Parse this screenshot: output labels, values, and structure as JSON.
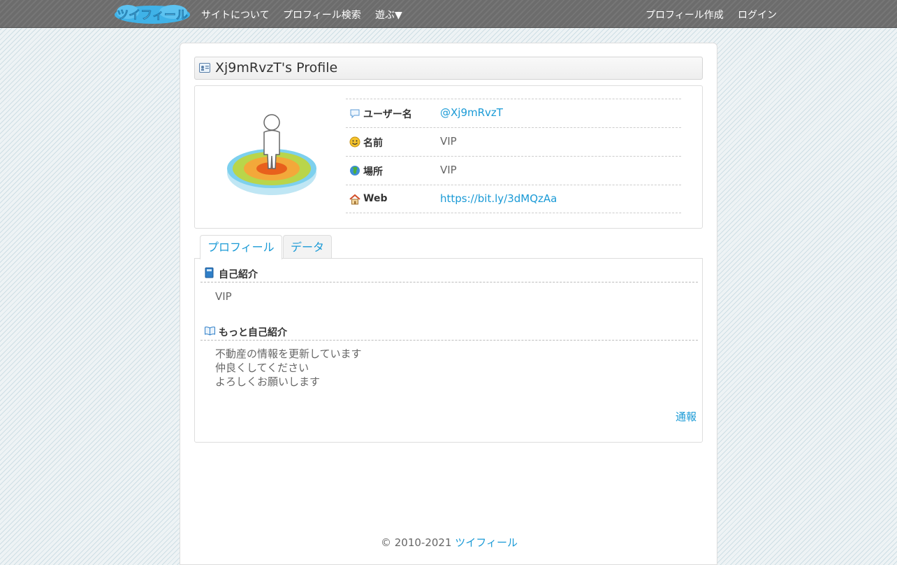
{
  "navbar": {
    "logo_text": "ツイフィール",
    "links_left": [
      "サイトについて",
      "プロフィール検索",
      "遊ぶ▼"
    ],
    "links_right": [
      "プロフィール作成",
      "ログイン"
    ]
  },
  "profile": {
    "title": "Xj9mRvzT's Profile",
    "fields": [
      {
        "label": "ユーザー名",
        "value": "@Xj9mRvzT",
        "icon": "speech-bubble-icon"
      },
      {
        "label": "名前",
        "value": "VIP",
        "icon": "smiley-icon"
      },
      {
        "label": "場所",
        "value": "VIP",
        "icon": "globe-icon"
      },
      {
        "label": "Web",
        "value": "https://bit.ly/3dMQzAa",
        "icon": "house-icon"
      }
    ]
  },
  "tabs": [
    "プロフィール",
    "データ"
  ],
  "sections": {
    "intro_title": "自己紹介",
    "intro_body": "VIP",
    "more_title": "もっと自己紹介",
    "more_lines": [
      "不動産の情報を更新しています",
      "仲良くしてください",
      "よろしくお願いします"
    ]
  },
  "report_label": "通報",
  "footer": {
    "copyright": "© 2010-2021",
    "site_link": "ツイフィール"
  },
  "colors": {
    "link": "#1a9ad6",
    "navbar": "#6c6c6c"
  }
}
